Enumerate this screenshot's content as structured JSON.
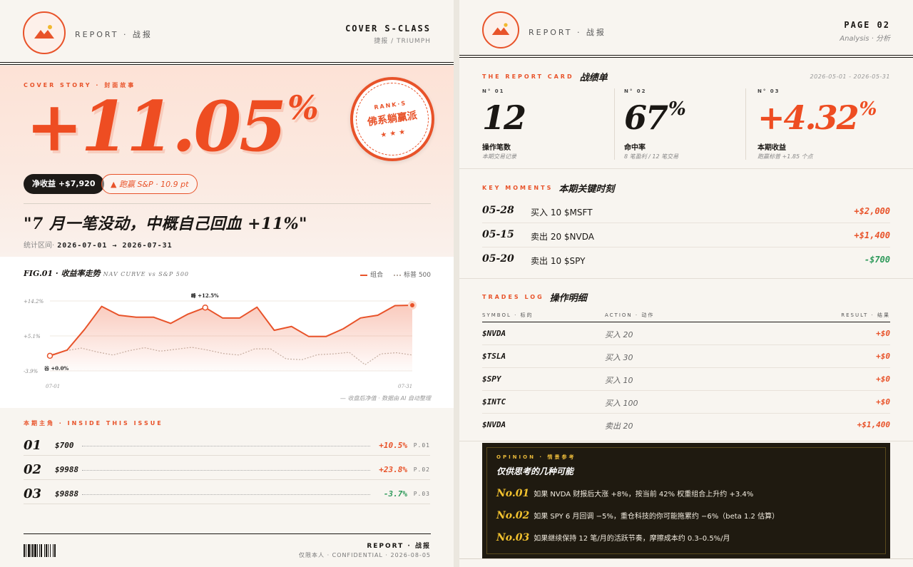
{
  "left": {
    "brand": "REPORT · 战报",
    "header_right": {
      "title": "COVER S-CLASS",
      "sub": "捷报 / TRIUMPH"
    },
    "cover": {
      "kicker": "COVER STORY · 封面故事",
      "big_value": "+11.05",
      "big_unit": "%",
      "rank": {
        "line1": "RANK·S",
        "line2": "佛系躺赢派",
        "stars": "★★★"
      },
      "pill_net": "净收益 +$7,920",
      "pill_beat": "▲ 跑赢 S&P · 10.9 pt",
      "headline": "\"7 月一笔没动，中概自己回血 +11%\"",
      "period_label": "统计区间·",
      "period_value": "2026-07-01 → 2026-07-31"
    },
    "figure": {
      "title": "FIG.01 · 收益率走势",
      "subtitle": "NAV CURVE vs S&P 500",
      "legend_portfolio": "组合",
      "legend_sp": "标普 500",
      "note": "— 收盘后净值 · 数据由 AI 自动整理"
    },
    "inside": {
      "kicker": "本期主角 · INSIDE THIS ISSUE",
      "items": [
        {
          "num": "01",
          "amount": "$700",
          "pct": "+10.5%",
          "page": "P.01"
        },
        {
          "num": "02",
          "amount": "$9988",
          "pct": "+23.8%",
          "page": "P.02"
        },
        {
          "num": "03",
          "amount": "$9888",
          "pct": "-3.7%",
          "page": "P.03"
        }
      ]
    },
    "footer": {
      "title": "REPORT · 战报",
      "sub": "仅限本人 · CONFIDENTIAL · 2026-08-05"
    }
  },
  "chart_data": {
    "type": "line",
    "title": "FIG.01 · 收益率走势",
    "subtitle": "NAV CURVE vs S&P 500",
    "x_labels": [
      "07-01",
      "07-31"
    ],
    "y_ticks": [
      "+14.2%",
      "+5.1%",
      "-3.9%"
    ],
    "ylim": [
      -3.9,
      14.2
    ],
    "series": [
      {
        "name": "组合",
        "values": [
          0.0,
          1.5,
          6.8,
          12.8,
          10.5,
          10.0,
          10.0,
          8.4,
          10.8,
          12.5,
          9.8,
          9.8,
          12.6,
          6.6,
          7.6,
          5.0,
          5.0,
          7.0,
          9.8,
          10.5,
          13.0,
          13.1
        ]
      },
      {
        "name": "标普 500",
        "values": [
          0.2,
          1.3,
          2.0,
          1.0,
          0.2,
          1.3,
          2.1,
          1.2,
          1.7,
          2.2,
          1.5,
          0.6,
          0.2,
          1.8,
          1.8,
          -0.8,
          -1.0,
          0.3,
          0.5,
          0.9,
          -2.3,
          0.5,
          0.8,
          0.2
        ]
      }
    ],
    "annotations": [
      {
        "label": "峰 +12.5%",
        "index": 9
      },
      {
        "label": "谷 +0.0%",
        "index": 0
      }
    ]
  },
  "right": {
    "brand": "REPORT · 战报",
    "header_right": {
      "title": "PAGE 02",
      "sub": "Analysis · 分析"
    },
    "report_card": {
      "kicker": "THE REPORT CARD",
      "title_zh": "战绩单",
      "dates": "2026-05-01 - 2026-05-31",
      "stats": [
        {
          "no": "N° 01",
          "value": "12",
          "unit": "",
          "label": "操作笔数",
          "note": "本期交易记录"
        },
        {
          "no": "N° 02",
          "value": "67",
          "unit": "%",
          "label": "命中率",
          "note": "8 笔盈利 / 12 笔交易"
        },
        {
          "no": "N° 03",
          "value": "+4.32",
          "unit": "%",
          "label": "本期收益",
          "note": "跑赢标普 +1.85 个点"
        }
      ]
    },
    "moments": {
      "kicker": "KEY MOMENTS",
      "title_zh": "本期关键时刻",
      "rows": [
        {
          "date": "05-28",
          "action": "买入 10 $MSFT",
          "result": "+$2,000",
          "color": "#e8532a"
        },
        {
          "date": "05-15",
          "action": "卖出 20 $NVDA",
          "result": "+$1,400",
          "color": "#e8532a"
        },
        {
          "date": "05-20",
          "action": "卖出 10 $SPY",
          "result": "-$700",
          "color": "#2f9a5b"
        }
      ]
    },
    "trades": {
      "kicker": "TRADES LOG",
      "title_zh": "操作明细",
      "headers": [
        "SYMBOL · 标的",
        "ACTION · 动作",
        "RESULT · 结果"
      ],
      "rows": [
        {
          "symbol": "$NVDA",
          "action": "买入 20",
          "result": "+$0"
        },
        {
          "symbol": "$TSLA",
          "action": "买入 30",
          "result": "+$0"
        },
        {
          "symbol": "$SPY",
          "action": "买入 10",
          "result": "+$0"
        },
        {
          "symbol": "$INTC",
          "action": "买入 100",
          "result": "+$0"
        },
        {
          "symbol": "$NVDA",
          "action": "卖出 20",
          "result": "+$1,400"
        }
      ]
    },
    "opinion": {
      "kicker": "OPINION · 情景参考",
      "title": "仅供思考的几种可能",
      "items": [
        {
          "n": "No.01",
          "text": "如果 NVDA 财报后大涨 +8%，按当前 42% 权重组合上升约 +3.4%"
        },
        {
          "n": "No.02",
          "text": "如果 SPY 6 月回调 −5%，重仓科技的你可能拖累约 −6%（beta 1.2 估算）"
        },
        {
          "n": "No.03",
          "text": "如果继续保持 12 笔/月的活跃节奏，摩擦成本约 0.3–0.5%/月"
        }
      ]
    }
  }
}
